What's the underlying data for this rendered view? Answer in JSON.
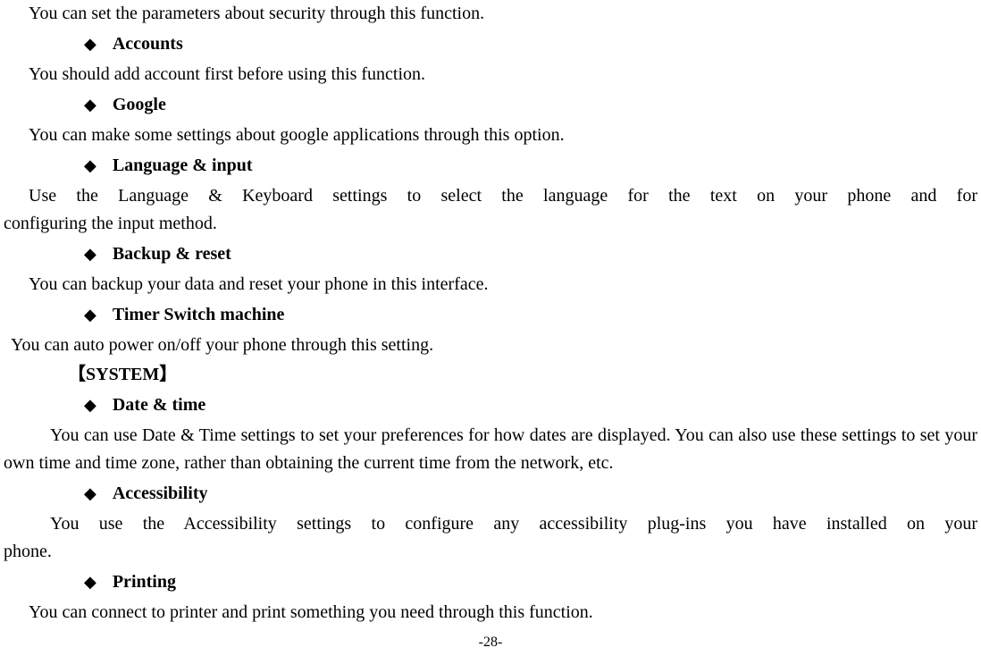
{
  "items": {
    "security_desc": "You can set the parameters about security through this function.",
    "accounts_label": "Accounts",
    "accounts_desc": "You should add account first before using this function.",
    "google_label": "Google",
    "google_desc": "You can make some settings about google applications through this option.",
    "language_label": "Language & input",
    "language_desc": "Use the Language & Keyboard settings to select the language for the text on your phone and for configuring the input method.",
    "backup_label": "Backup & reset",
    "backup_desc": "You can backup your data and reset your phone in this interface.",
    "timer_label": "Timer Switch machine",
    "timer_desc": "You can auto power on/off your phone through this setting.",
    "system_header": "【SYSTEM】",
    "datetime_label": "Date & time",
    "datetime_desc": "You can use Date & Time settings to set your preferences for how dates are displayed. You can also use these settings to set your own time and time zone, rather than obtaining the current time from the network, etc.",
    "accessibility_label": "Accessibility",
    "accessibility_desc": "You use the Accessibility settings to configure any accessibility plug-ins you have installed on your phone.",
    "printing_label": "Printing",
    "printing_desc": "You can connect to printer and print something you need through this function."
  },
  "page_number": "-28-",
  "bullet_glyph": "◆"
}
